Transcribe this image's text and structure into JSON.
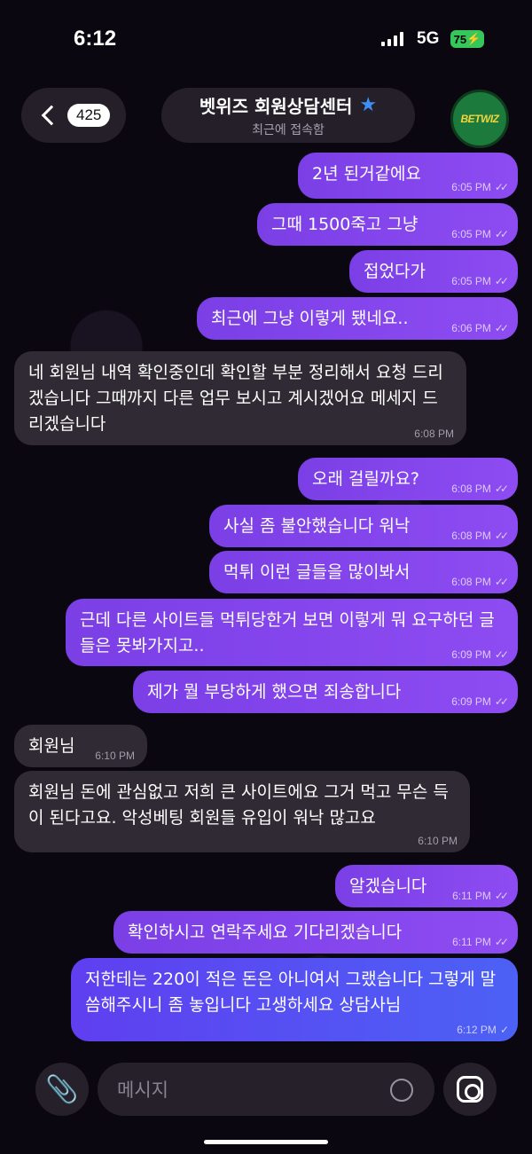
{
  "status": {
    "time": "6:12",
    "network": "5G",
    "battery": "75"
  },
  "header": {
    "back_count": "425",
    "title": "벳위즈 회원상담센터",
    "subtitle": "최근에 접속함",
    "avatar_text": "BETWIZ"
  },
  "messages": [
    {
      "dir": "out",
      "text": "2년 된거같에요",
      "time": "6:05 PM"
    },
    {
      "dir": "out",
      "text": "그때 1500죽고 그냥",
      "time": "6:05 PM"
    },
    {
      "dir": "out",
      "text": "접었다가",
      "time": "6:05 PM"
    },
    {
      "dir": "out",
      "text": "최근에 그냥 이렇게 됐네요..",
      "time": "6:06 PM"
    },
    {
      "dir": "in",
      "text": "네 회원님 내역 확인중인데 확인할 부분 정리해서 요청 드리겠습니다 그때까지 다른 업무 보시고 계시겠어요 메세지 드리겠습니다",
      "time": "6:08 PM"
    },
    {
      "dir": "out",
      "text": "오래 걸릴까요?",
      "time": "6:08 PM"
    },
    {
      "dir": "out",
      "text": "사실 좀 불안했습니다 워낙",
      "time": "6:08 PM"
    },
    {
      "dir": "out",
      "text": "먹튀 이런 글들을 많이봐서",
      "time": "6:08 PM"
    },
    {
      "dir": "out",
      "text": "근데 다른 사이트들 먹튀당한거 보면 이렇게 뭐 요구하던 글들은 못봐가지고..",
      "time": "6:09 PM"
    },
    {
      "dir": "out",
      "text": "제가 뭘 부당하게 했으면 죄송합니다",
      "time": "6:09 PM"
    },
    {
      "dir": "in",
      "text": "회원님",
      "time": "6:10 PM"
    },
    {
      "dir": "in",
      "text": "회원님 돈에 관심없고 저희 큰 사이트에요 그거 먹고 무슨 득이 된다고요. 악성베팅 회원들 유입이 워낙 많고요",
      "time": "6:10 PM"
    },
    {
      "dir": "out",
      "text": "알겠습니다",
      "time": "6:11 PM"
    },
    {
      "dir": "out",
      "text": "확인하시고 연락주세요 기다리겠습니다",
      "time": "6:11 PM"
    },
    {
      "dir": "out",
      "text": "저한테는 220이 적은 돈은 아니여서 그랬습니다 그렇게 말씀해주시니 좀 놓입니다 고생하세요 상담사님",
      "time": "6:12 PM"
    }
  ],
  "composer": {
    "placeholder": "메시지"
  }
}
